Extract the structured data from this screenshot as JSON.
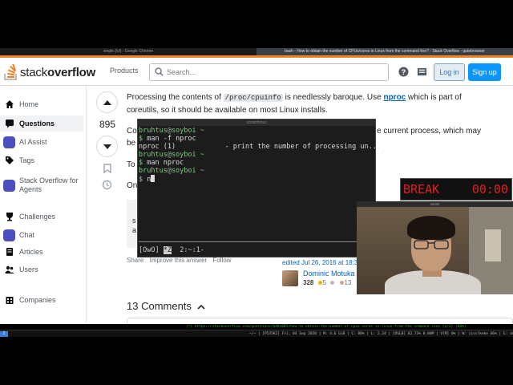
{
  "windows": {
    "left_title": "single.(lvl) - Google Chrome",
    "right_title": "bash - How to obtain the number of CPUs/cores in Linux from the command line? - Stack Overflow - qutebrowser"
  },
  "so": {
    "logo_text_regular": "stack",
    "logo_text_bold": "overflow",
    "products": "Products",
    "search_placeholder": "Search...",
    "login": "Log in",
    "signup": "Sign up",
    "brand_color": "#f48024"
  },
  "sidebar": {
    "items": [
      {
        "label": "Home",
        "icon": "home-icon"
      },
      {
        "label": "Questions",
        "icon": "questions-icon"
      },
      {
        "label": "AI Assist",
        "icon": "ai-assist-icon"
      },
      {
        "label": "Tags",
        "icon": "tags-icon"
      },
      {
        "label_line1": "Stack Overflow for",
        "label_line2": "Agents",
        "icon": "agents-icon"
      },
      {
        "label": "Challenges",
        "icon": "challenges-icon"
      },
      {
        "label": "Chat",
        "icon": "chat-icon"
      },
      {
        "label": "Articles",
        "icon": "articles-icon"
      },
      {
        "label": "Users",
        "icon": "users-icon"
      },
      {
        "label": "Companies",
        "icon": "companies-icon"
      }
    ]
  },
  "answer": {
    "votes": "895",
    "p1_a": "Processing the contents of ",
    "p1_code": "/proc/cpuinfo",
    "p1_b": " is needlessly baroque. Use ",
    "p1_link": "nproc",
    "p1_c": " which is part of",
    "p1_line2": "coreutils, so it should be available on most Linux installs.",
    "frag_co": "Co",
    "frag_be": "be",
    "frag_to": "To",
    "frag_on": "On",
    "frag_right1": "e current process, which may",
    "frag_s": "s",
    "frag_a": "a",
    "share": "Share",
    "improve": "Improve this answer",
    "follow": "Follow",
    "edited": "edited Jul 26, 2016 at 18:3",
    "editor_name": "Dominic Motuka",
    "editor_rep": "328",
    "gold": "5",
    "silver": "",
    "bronze": "13",
    "comments": "13 Comments"
  },
  "terminal": {
    "title": "scratchmux",
    "lines": [
      {
        "prompt": "bruhtus@soyboi ~",
        "cmd": ""
      },
      {
        "prompt": "$",
        "cmd": " man -f nproc"
      },
      {
        "out": "nproc (1)            - print the number of processing un..."
      },
      {
        "prompt": "bruhtus@soyboi ~",
        "cmd": ""
      },
      {
        "prompt": "$",
        "cmd": " man nproc"
      },
      {
        "prompt": "bruhtus@soyboi ~",
        "cmd": ""
      },
      {
        "prompt": "$",
        "cmd": " n"
      }
    ],
    "status_session": "[OwO]",
    "status_window": "*Z",
    "status_rest": "2:~:1-"
  },
  "timer": {
    "label": "BREAK",
    "time": "00:00"
  },
  "webcam": {
    "title": "satitst"
  },
  "statusbar": {
    "url": "[*] https://stackoverflow.com/questions/6481005/how-to-obtain-the-number-of-cpus-cores-in-linux-from-the-command-line [2/2] [88%]",
    "workspace": "2",
    "info": "~/~ | [P535K2] Fri, 04 Sep 2020 | M: 4.6 GiB | C: 08% | L: 2.24 | [DSLB] 82.73% 0.00M | V[M] 0% | W: iisslkeke 66% | E: down"
  }
}
